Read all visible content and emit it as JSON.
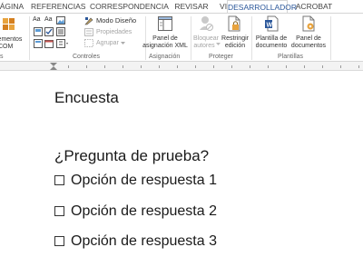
{
  "tabs": [
    {
      "label": "ÁGINA"
    },
    {
      "label": "REFERENCIAS"
    },
    {
      "label": "CORRESPONDENCIA"
    },
    {
      "label": "REVISAR"
    },
    {
      "label": "VISTA"
    },
    {
      "label": "DESARROLLADOR"
    },
    {
      "label": "ACROBAT"
    }
  ],
  "active_tab": "DESARROLLADOR",
  "ribbon": {
    "com_label_1": "lementos",
    "com_label_2": "COM",
    "controls": {
      "modo_diseno": "Modo Diseño",
      "propiedades": "Propiedades",
      "agrupar": "Agrupar",
      "group_label": "Controles"
    },
    "asignacion": {
      "panel_label_1": "Panel de",
      "panel_label_2": "asignación XML",
      "group_label": "Asignación"
    },
    "proteger": {
      "bloquear_1": "Bloquear",
      "bloquear_2": "autores",
      "restringir_1": "Restringir",
      "restringir_2": "edición",
      "group_label": "Proteger"
    },
    "plantillas": {
      "plantilla_1": "Plantilla de",
      "plantilla_2": "documento",
      "panel_1": "Panel de",
      "panel_2": "documentos",
      "group_label": "Plantillas"
    },
    "left_group_label": "s"
  },
  "document": {
    "title": "Encuesta",
    "question": "¿Pregunta de prueba?",
    "options": [
      {
        "label": "Opción de respuesta 1"
      },
      {
        "label": "Opción de respuesta 2"
      },
      {
        "label": "Opción de respuesta 3"
      }
    ]
  },
  "colors": {
    "accent": "#2b579a",
    "disabled": "#a5a5a5"
  }
}
